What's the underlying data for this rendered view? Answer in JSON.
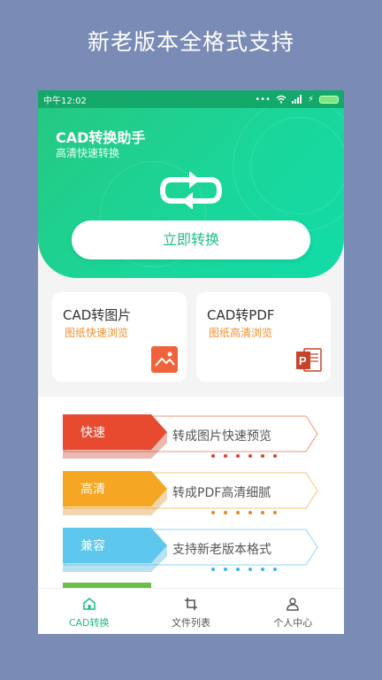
{
  "promo": {
    "title": "新老版本全格式支持"
  },
  "status_bar": {
    "time": "中午12:02"
  },
  "hero": {
    "title": "CAD转换助手",
    "subtitle": "高清快速转换",
    "convert_button": "立即转换",
    "icon": "swap-arrows-icon"
  },
  "cards": [
    {
      "title": "CAD转图片",
      "subtitle": "图纸快速浏览",
      "icon": "image-icon",
      "icon_color": "#f0633a"
    },
    {
      "title": "CAD转PDF",
      "subtitle": "图纸高清浏览",
      "icon": "powerpoint-icon",
      "icon_color": "#c6432c"
    }
  ],
  "features": [
    {
      "tag": "快速",
      "text": "转成图片快速预览",
      "color": "#e84a2f",
      "border": "#f0957e",
      "dot": "#d8432f"
    },
    {
      "tag": "高清",
      "text": "转成PDF高清细腻",
      "color": "#f5a623",
      "border": "#f5c778",
      "dot": "#e0892b"
    },
    {
      "tag": "兼容",
      "text": "支持新老版本格式",
      "color": "#5ec7ee",
      "border": "#8ed8f3",
      "dot": "#3ab7e6"
    }
  ],
  "tabbar": {
    "active_color": "#1fbf82",
    "tabs": [
      {
        "label": "CAD转换",
        "icon": "home-icon"
      },
      {
        "label": "文件列表",
        "icon": "crop-icon"
      },
      {
        "label": "个人中心",
        "icon": "user-icon"
      }
    ]
  }
}
